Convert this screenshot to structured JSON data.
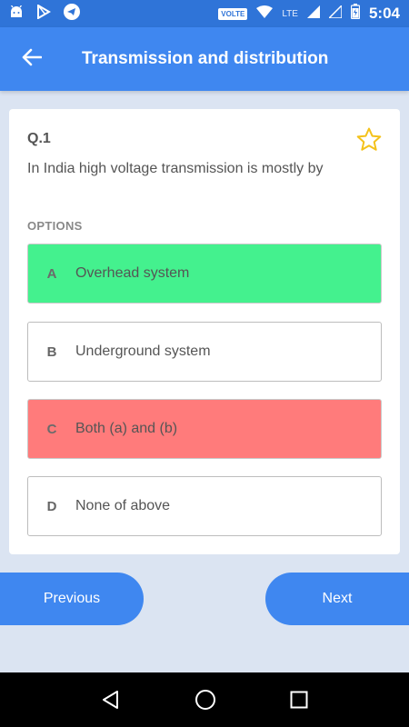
{
  "status_bar": {
    "volte": "VOLTE",
    "network": "LTE",
    "time": "5:04",
    "icons": [
      "android-icon",
      "play-store-icon",
      "telegram-icon",
      "wifi-icon",
      "signal-icon",
      "battery-charging-icon"
    ]
  },
  "header": {
    "title": "Transmission and distribution",
    "back_icon": "back-arrow-icon",
    "color": "#3f87f0"
  },
  "question": {
    "number": "Q.1",
    "text": "In India high voltage transmission is mostly by",
    "bookmark_icon": "star-outline-icon"
  },
  "options_heading": "OPTIONS",
  "options": [
    {
      "letter": "A",
      "text": "Overhead system",
      "state": "correct",
      "color": "#44f18e"
    },
    {
      "letter": "B",
      "text": "Underground system",
      "state": "neutral"
    },
    {
      "letter": "C",
      "text": "Both (a) and (b)",
      "state": "wrong",
      "color": "#ff7b7b"
    },
    {
      "letter": "D",
      "text": "None of above",
      "state": "neutral"
    }
  ],
  "footer": {
    "previous_label": "Previous",
    "next_label": "Next"
  },
  "system_nav": {
    "icons": [
      "back-triangle-icon",
      "home-circle-icon",
      "recents-square-icon"
    ]
  }
}
